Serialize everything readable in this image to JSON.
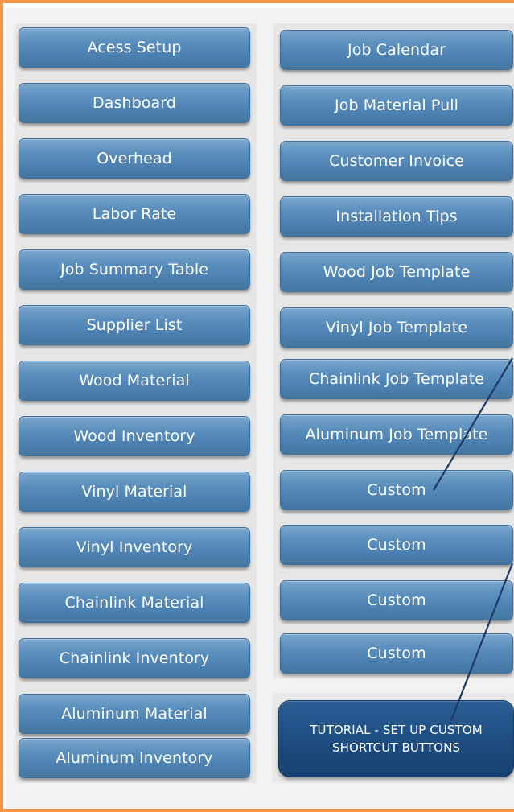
{
  "left_buttons": [
    "Acess Setup",
    "Dashboard",
    "Overhead",
    "Labor Rate",
    "Job Summary Table",
    "Supplier List",
    "Wood Material",
    "Wood Inventory",
    "Vinyl Material",
    "Vinyl Inventory",
    "Chainlink Material",
    "Chainlink Inventory",
    "Aluminum Material",
    "Aluminum Inventory"
  ],
  "right_buttons": [
    "Job Calendar",
    "Job Material Pull",
    "Customer Invoice",
    "Installation Tips",
    "Wood Job Template",
    "Vinyl Job Template",
    "Chainlink Job Template",
    "Aluminum Job Template",
    "Custom",
    "Custom",
    "Custom",
    "Custom"
  ],
  "tutorial": {
    "line1": "TUTORIAL - SET UP CUSTOM",
    "line2": "SHORTCUT BUTTONS"
  },
  "colors": {
    "frame": "#f79646",
    "button": "#4b80b1",
    "tutorial_button": "#1f4f85",
    "annotation_line": "#1f3864"
  }
}
